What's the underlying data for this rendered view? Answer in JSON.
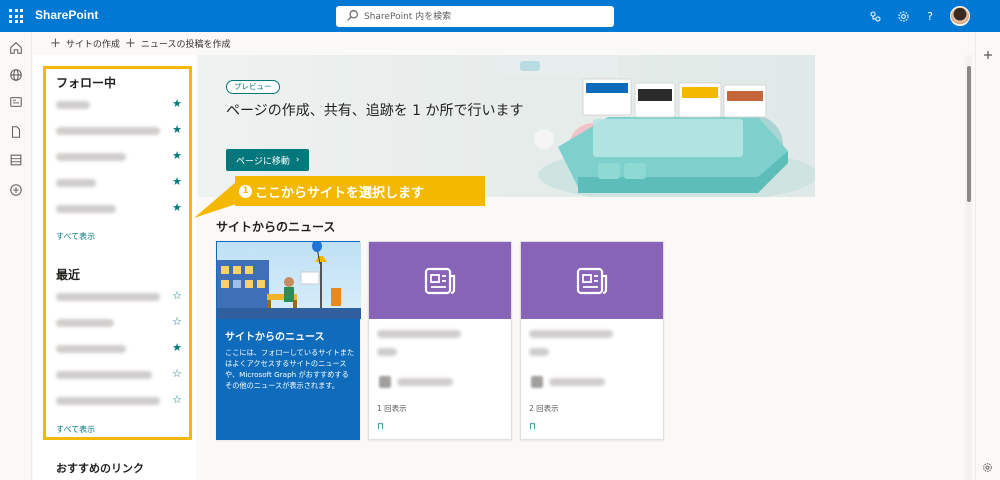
{
  "topbar": {
    "brand": "SharePoint",
    "search_placeholder": "SharePoint 内を検索",
    "help": "?"
  },
  "commands": [
    {
      "label": "サイトの作成"
    },
    {
      "label": "ニュースの投稿を作成"
    }
  ],
  "nav": {
    "following_heading": "フォロー中",
    "following_items": [
      {
        "starred": true
      },
      {
        "starred": true
      },
      {
        "starred": true
      },
      {
        "starred": true
      },
      {
        "starred": true
      }
    ],
    "following_show_all": "すべて表示",
    "recent_heading": "最近",
    "recent_items": [
      {
        "starred": false
      },
      {
        "starred": false
      },
      {
        "starred": true
      },
      {
        "starred": false
      },
      {
        "starred": false
      }
    ],
    "recent_show_all": "すべて表示",
    "recommended_heading": "おすすめのリンク"
  },
  "hero": {
    "badge": "プレビュー",
    "title": "ページの作成、共有、追跡を 1 か所で行います",
    "button": "ページに移動"
  },
  "callout": {
    "number": "1",
    "text": "ここからサイトを選択します"
  },
  "news": {
    "heading": "サイトからのニュース",
    "cards": [
      {
        "title": "サイトからのニュース",
        "description": "ここには、フォローしているサイトまたはよくアクセスするサイトのニュースや、Microsoft Graph がおすすめするその他のニュースが表示されます。"
      },
      {
        "views": "1 回表示"
      },
      {
        "views": "2 回表示"
      }
    ]
  },
  "colors": {
    "suite_bar": "#0078d4",
    "accent": "#03787c",
    "callout": "#f5b800",
    "news_purple": "#8764b8",
    "news_blue": "#0f6cbd"
  }
}
